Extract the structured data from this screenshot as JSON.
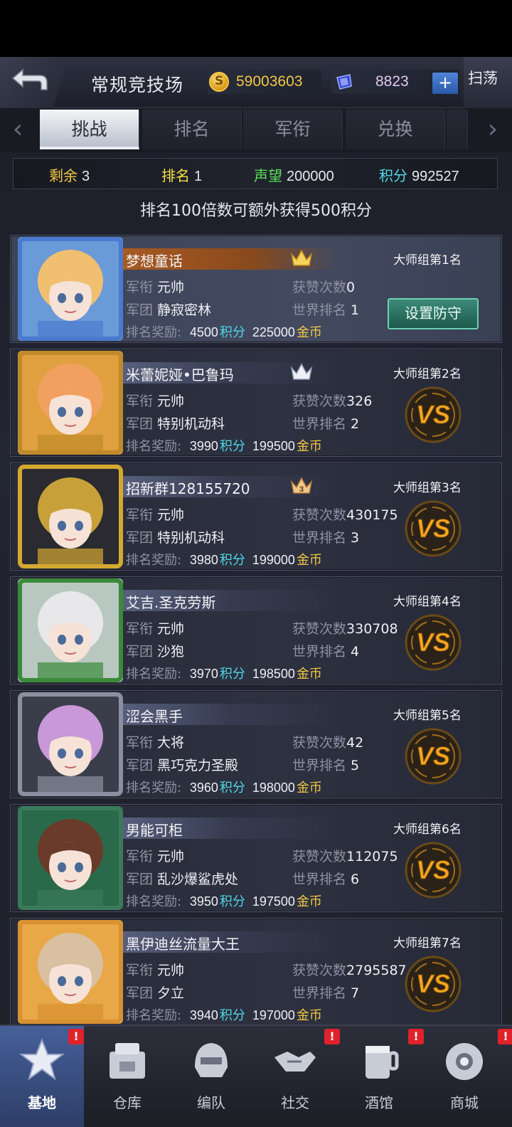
{
  "header": {
    "title": "常规竞技场",
    "coins": "59003603",
    "gems": "8823",
    "plus": "+",
    "sweep_label": "扫荡"
  },
  "tabs": [
    {
      "label": "挑战",
      "active": true
    },
    {
      "label": "排名",
      "active": false
    },
    {
      "label": "军衔",
      "active": false
    },
    {
      "label": "兑换",
      "active": false
    }
  ],
  "stats": {
    "remaining_label": "剩余",
    "remaining": "3",
    "rank_label": "排名",
    "rank": "1",
    "prestige_label": "声望",
    "prestige": "200000",
    "points_label": "积分",
    "points": "992527"
  },
  "notice": "排名100倍数可额外获得500积分",
  "labels": {
    "rank_title": "军衔",
    "corps": "军团",
    "likes": "获赞次数",
    "world_rank": "世界排名",
    "reward": "排名奖励:",
    "points_unit": "积分",
    "gold_unit": "金币",
    "defend_button": "设置防守",
    "vs": "VS"
  },
  "players": [
    {
      "name": "梦想童话",
      "group": "大师组第1名",
      "rank_title": "元帅",
      "corps": "静寂密林",
      "likes": "0",
      "world_rank": "1",
      "reward_points": "4500",
      "reward_gold": "225000",
      "crown": "gold",
      "crown_num": "",
      "self": true
    },
    {
      "name": "米蕾妮娅•巴鲁玛",
      "group": "大师组第2名",
      "rank_title": "元帅",
      "corps": "特别机动科",
      "likes": "326",
      "world_rank": "2",
      "reward_points": "3990",
      "reward_gold": "199500",
      "crown": "silver",
      "crown_num": "",
      "self": false
    },
    {
      "name": "招新群128155720",
      "group": "大师组第3名",
      "rank_title": "元帅",
      "corps": "特别机动科",
      "likes": "430175",
      "world_rank": "3",
      "reward_points": "3980",
      "reward_gold": "199000",
      "crown": "bronze",
      "crown_num": "3",
      "self": false
    },
    {
      "name": "艾吉.圣克劳斯",
      "group": "大师组第4名",
      "rank_title": "元帅",
      "corps": "沙狍",
      "likes": "330708",
      "world_rank": "4",
      "reward_points": "3970",
      "reward_gold": "198500",
      "crown": "",
      "crown_num": "",
      "self": false
    },
    {
      "name": "涩会黑手",
      "group": "大师组第5名",
      "rank_title": "大将",
      "corps": "黑巧克力圣殿",
      "likes": "42",
      "world_rank": "5",
      "reward_points": "3960",
      "reward_gold": "198000",
      "crown": "",
      "crown_num": "",
      "self": false
    },
    {
      "name": "男能可柜",
      "group": "大师组第6名",
      "rank_title": "元帅",
      "corps": "乱沙爆鲨虎处",
      "likes": "112075",
      "world_rank": "6",
      "reward_points": "3950",
      "reward_gold": "197500",
      "crown": "",
      "crown_num": "",
      "self": false
    },
    {
      "name": "黑伊迪丝流量大王",
      "group": "大师组第7名",
      "rank_title": "元帅",
      "corps": "夕立",
      "likes": "2795587",
      "world_rank": "7",
      "reward_points": "3940",
      "reward_gold": "197000",
      "crown": "",
      "crown_num": "",
      "self": false
    }
  ],
  "avatar_style": [
    {
      "bg": "#6b9ad8",
      "hair": "#f0c070",
      "frame": "#4a7ad0",
      "icon": "avatar-anime-girl-blonde"
    },
    {
      "bg": "#e0a040",
      "hair": "#f2a060",
      "frame": "#c08a2a",
      "icon": "avatar-anime-girl-cards"
    },
    {
      "bg": "#2a2a30",
      "hair": "#c8a03a",
      "frame": "#d4a830",
      "icon": "avatar-mecha-gold"
    },
    {
      "bg": "#b8c8c0",
      "hair": "#e8e8ea",
      "frame": "#3a8a3a",
      "icon": "avatar-anime-girl-christmas"
    },
    {
      "bg": "#3a3e4a",
      "hair": "#c898d8",
      "frame": "#8a90a0",
      "icon": "avatar-anime-girl-purple"
    },
    {
      "bg": "#2a6a4a",
      "hair": "#6a3a2a",
      "frame": "#3a7a5a",
      "icon": "avatar-man-mustache"
    },
    {
      "bg": "#e8a848",
      "hair": "#d8c0a0",
      "frame": "#d89030",
      "icon": "avatar-anime-girl-brown"
    }
  ],
  "nav": [
    {
      "label": "基地",
      "icon": "base-star-icon",
      "active": true,
      "badge": "!"
    },
    {
      "label": "仓库",
      "icon": "warehouse-icon",
      "active": false,
      "badge": ""
    },
    {
      "label": "编队",
      "icon": "formation-helmet-icon",
      "active": false,
      "badge": ""
    },
    {
      "label": "社交",
      "icon": "handshake-icon",
      "active": false,
      "badge": "!"
    },
    {
      "label": "酒馆",
      "icon": "tavern-mug-icon",
      "active": false,
      "badge": "!"
    },
    {
      "label": "商城",
      "icon": "shop-capsule-icon",
      "active": false,
      "badge": "!"
    }
  ],
  "colors": {
    "gold": "#f2c845",
    "cyan": "#4ed8e8",
    "green": "#5de25a",
    "vs_orange": "#f0a020"
  }
}
